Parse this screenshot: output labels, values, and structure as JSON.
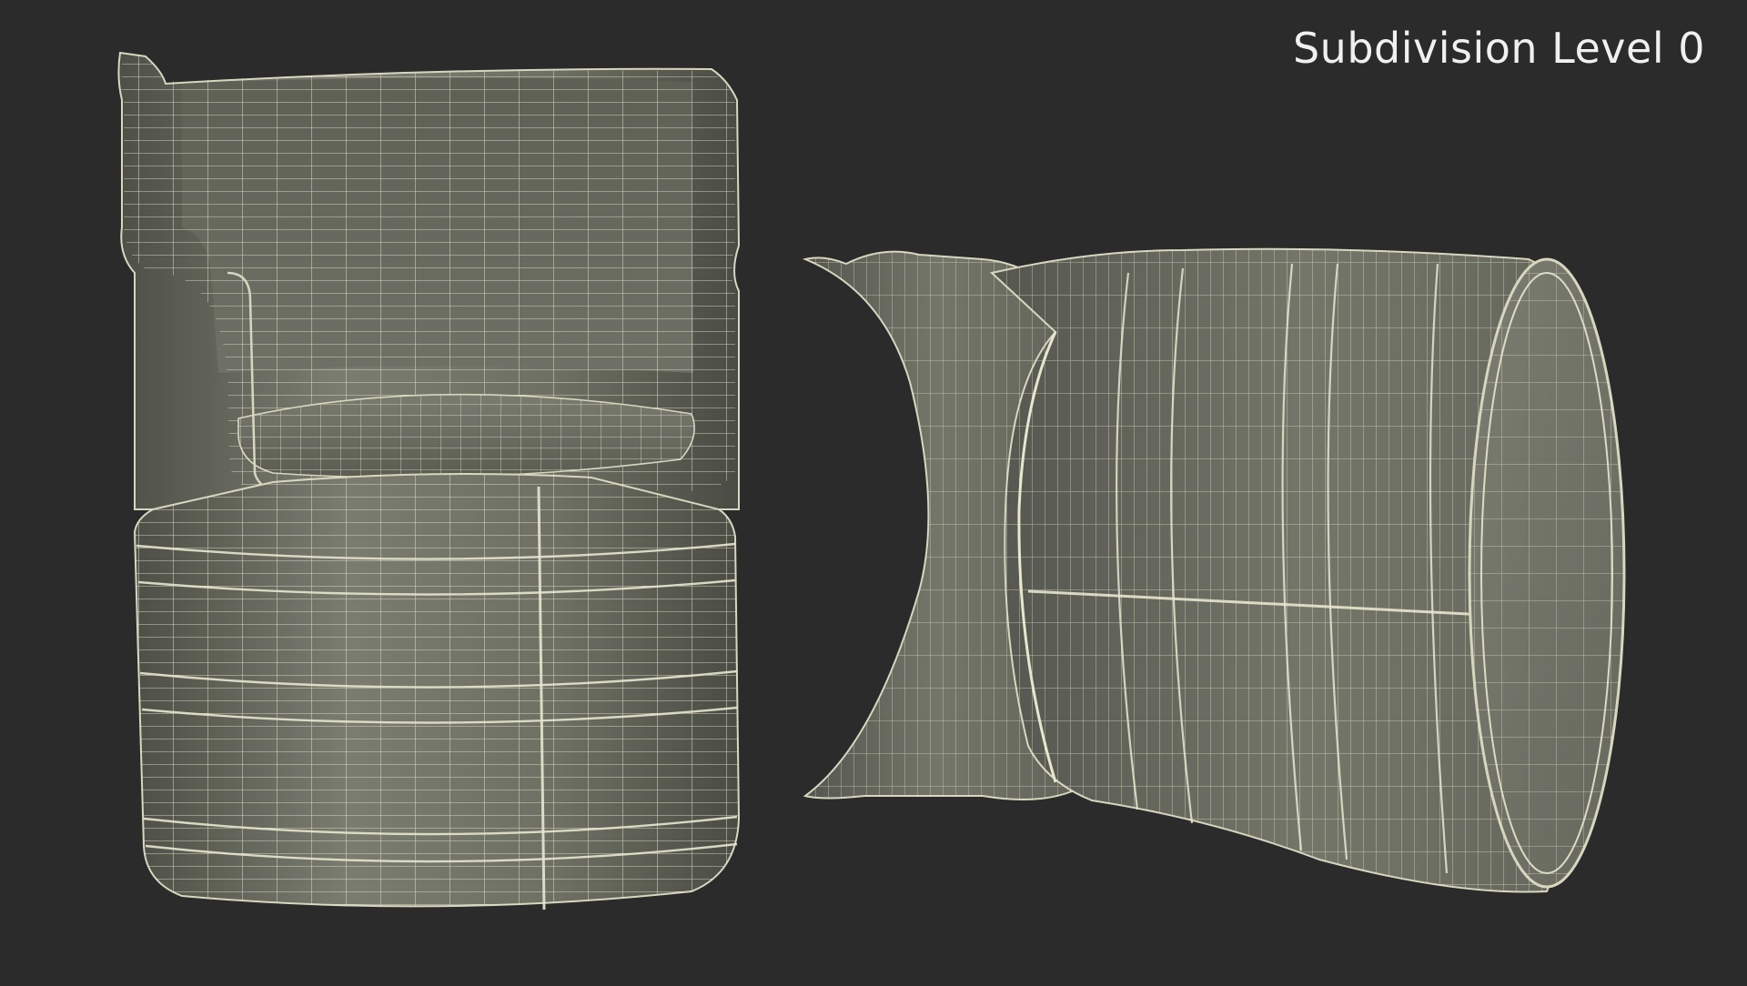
{
  "caption": "Subdivision Level 0"
}
